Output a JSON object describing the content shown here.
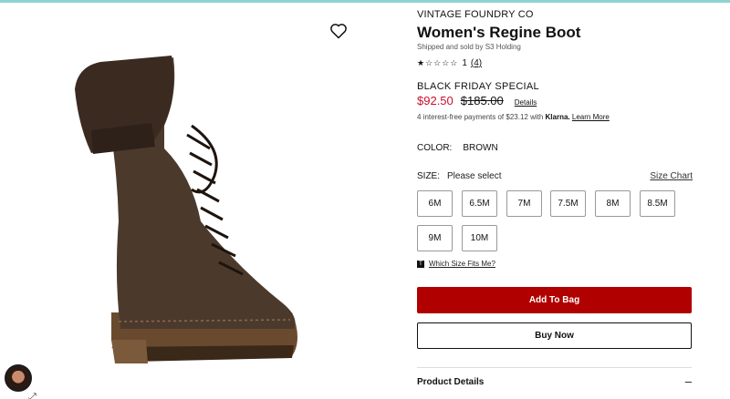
{
  "product": {
    "brand": "VINTAGE FOUNDRY CO",
    "title": "Women's Regine Boot",
    "shipped_by": "Shipped and sold by S3 Holding",
    "rating_stars": "★☆☆☆☆",
    "rating_value": "1",
    "review_count": "(4)",
    "promo_label": "BLACK FRIDAY SPECIAL",
    "sale_price": "$92.50",
    "original_price": "$185.00",
    "price_details_link": "Details",
    "klarna_prefix": "4 interest-free payments of $23.12 with ",
    "klarna_brand": "Klarna.",
    "klarna_learn_more": "Learn More"
  },
  "color": {
    "label": "COLOR:",
    "value": "BROWN"
  },
  "size": {
    "label": "SIZE:",
    "selection": "Please select",
    "chart_link": "Size Chart",
    "options": [
      "6M",
      "6.5M",
      "7M",
      "7.5M",
      "8M",
      "8.5M",
      "9M",
      "10M"
    ],
    "fit_link": "Which Size Fits Me?"
  },
  "actions": {
    "add_to_bag": "Add To Bag",
    "buy_now": "Buy Now"
  },
  "sections": {
    "product_details": "Product Details",
    "toggle_symbol": "–"
  },
  "icons": {
    "wishlist": "heart-icon",
    "expand": "expand-icon",
    "fit": "fit-guide-icon"
  },
  "colors": {
    "accent_red": "#b10000",
    "sale_red": "#c8102e",
    "top_bar": "#8fd3d0"
  }
}
